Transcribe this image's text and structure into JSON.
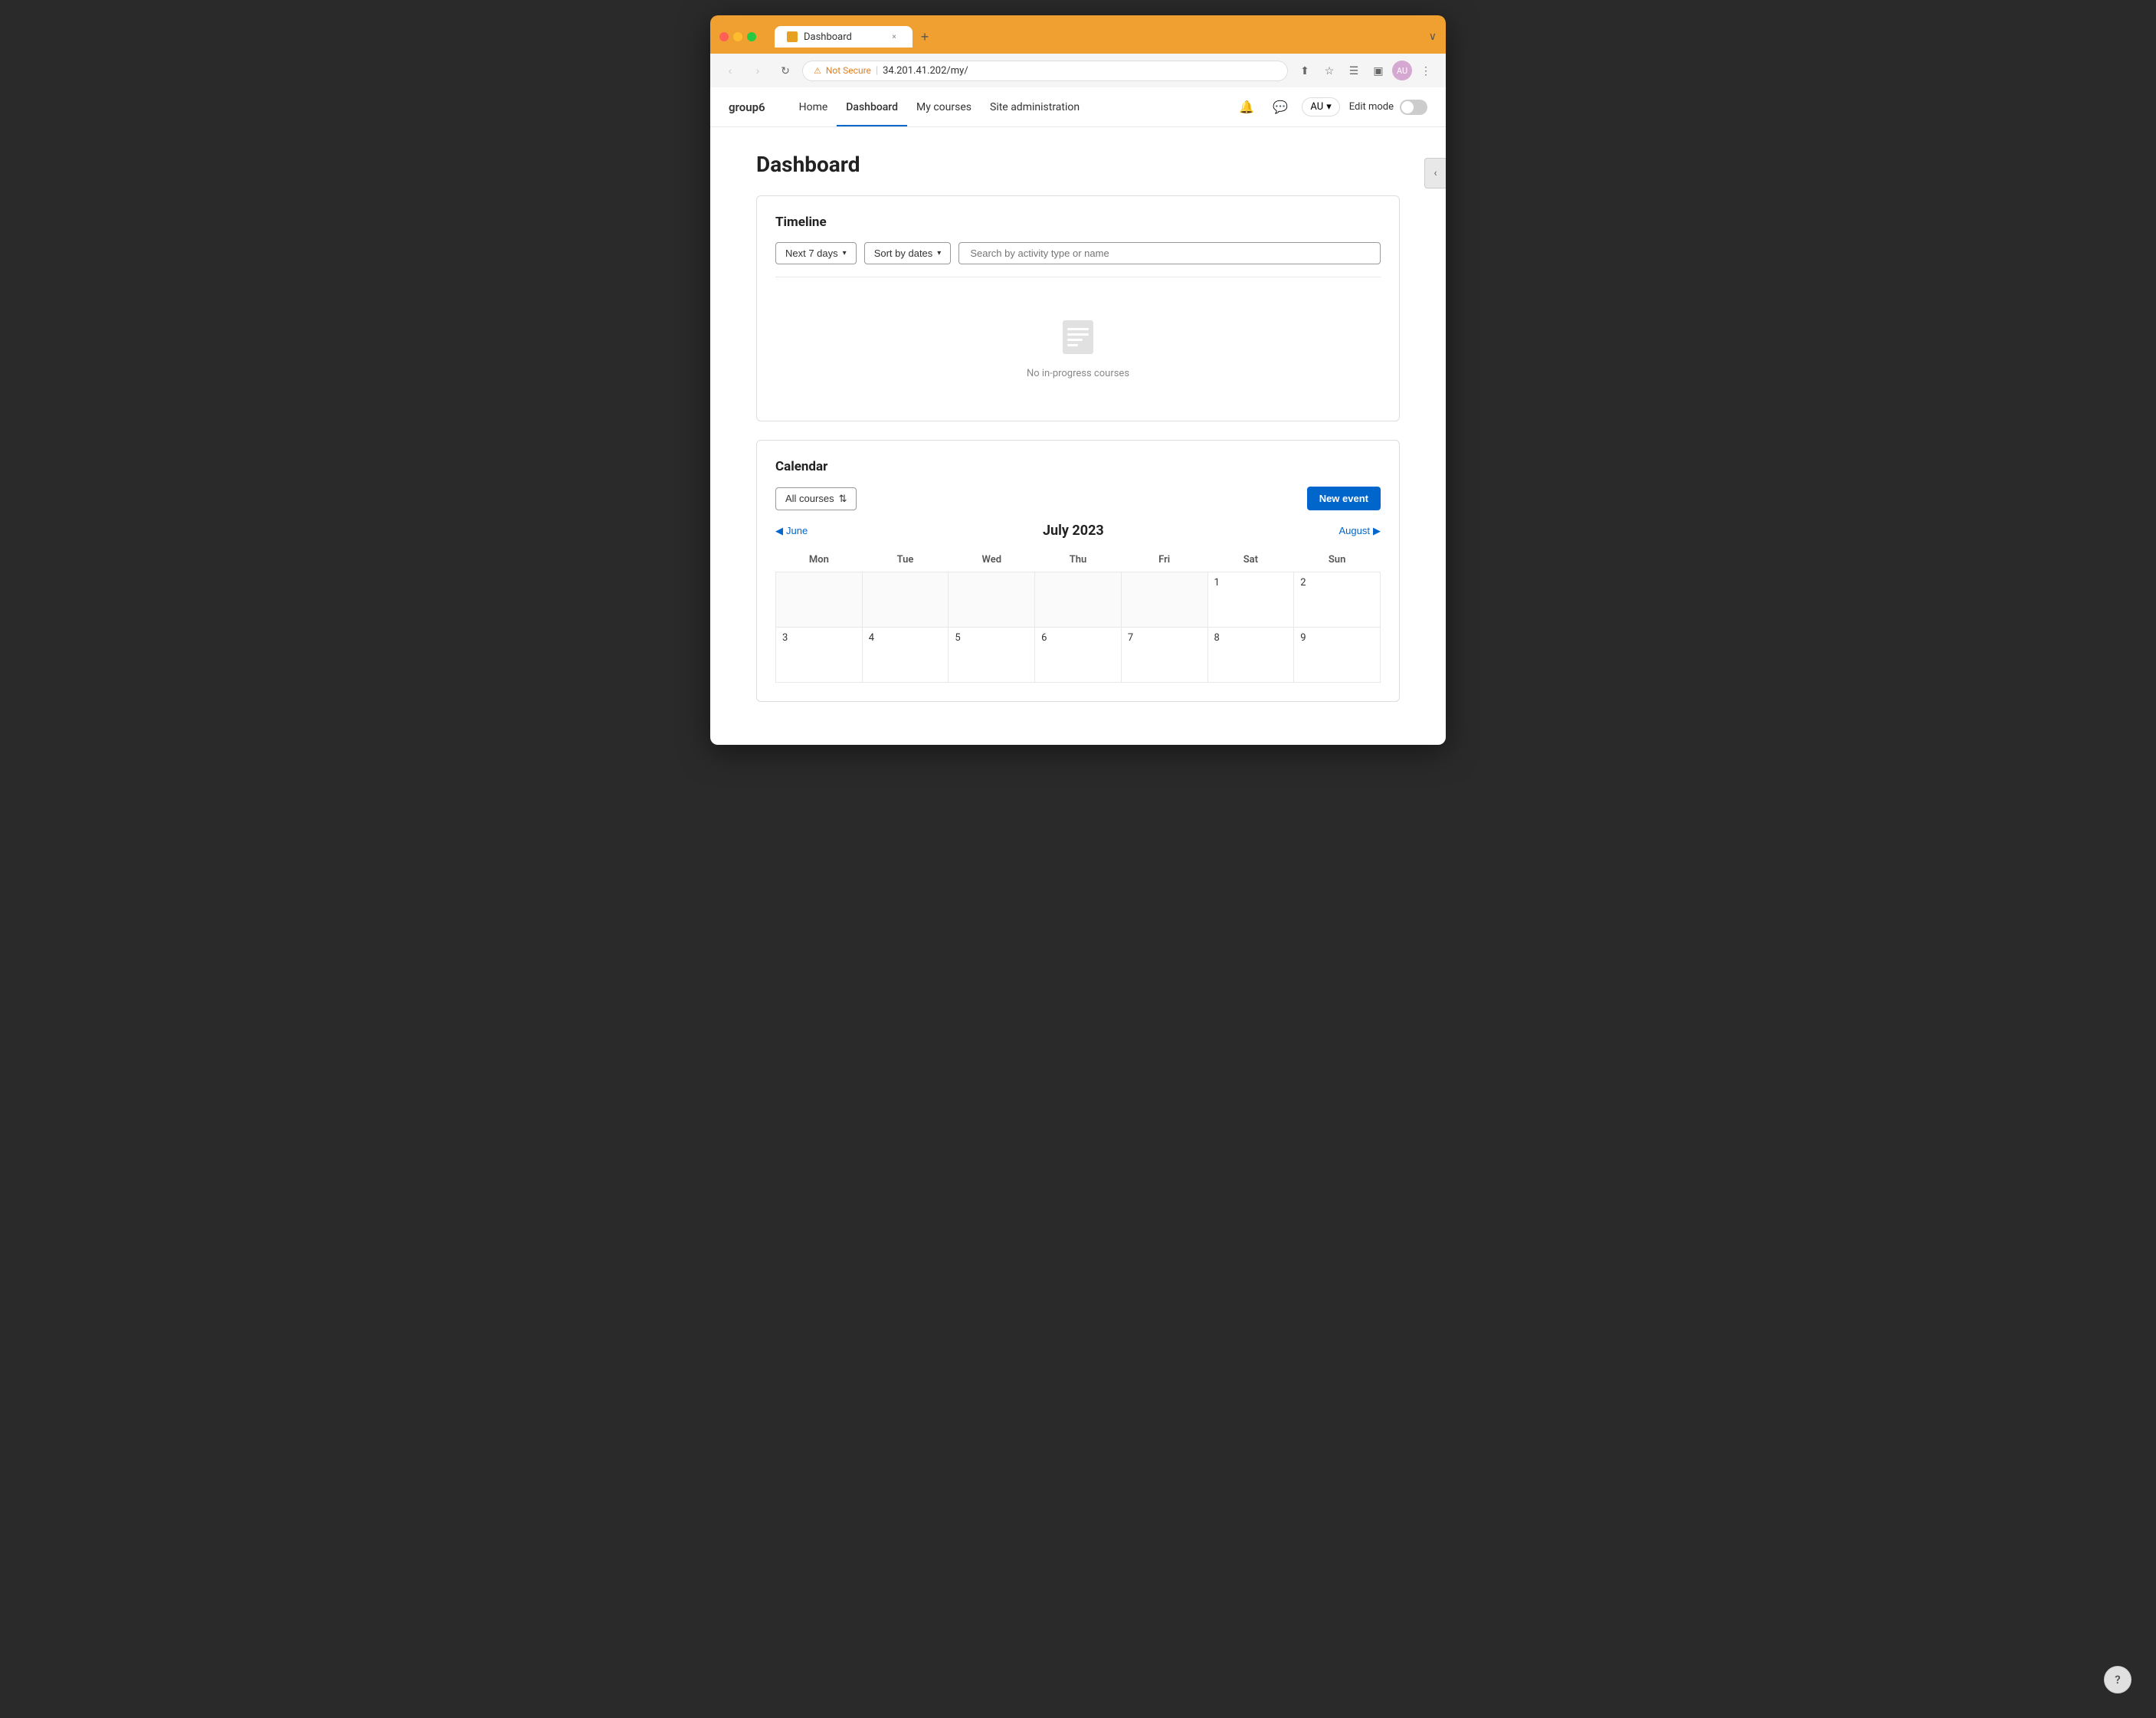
{
  "browser": {
    "tab_title": "Dashboard",
    "tab_close": "×",
    "tab_new": "+",
    "nav_back": "‹",
    "nav_forward": "›",
    "nav_reload": "↻",
    "address_not_secure": "Not Secure",
    "address_separator": "|",
    "address_url": "34.201.41.202/my/",
    "more_menu": "⋮",
    "chevron_down": "∨",
    "action_share": "⬆",
    "action_bookmark": "☆",
    "action_menu": "☰",
    "action_sidebar": "▣",
    "user_avatar_text": "AU"
  },
  "nav": {
    "logo": "group6",
    "links": [
      {
        "label": "Home",
        "active": false
      },
      {
        "label": "Dashboard",
        "active": true
      },
      {
        "label": "My courses",
        "active": false
      },
      {
        "label": "Site administration",
        "active": false
      }
    ],
    "bell_icon": "🔔",
    "chat_icon": "💬",
    "user_label": "AU",
    "user_chevron": "▾",
    "edit_mode_label": "Edit mode"
  },
  "page": {
    "title": "Dashboard"
  },
  "timeline": {
    "section_title": "Timeline",
    "filter_label": "Next 7 days",
    "filter_chevron": "▾",
    "sort_label": "Sort by dates",
    "sort_chevron": "▾",
    "search_placeholder": "Search by activity type or name",
    "empty_text": "No in-progress courses"
  },
  "calendar": {
    "section_title": "Calendar",
    "all_courses_label": "All courses",
    "all_courses_icon": "⇅",
    "new_event_label": "New event",
    "prev_month": "June",
    "prev_arrow": "◀",
    "next_month": "August",
    "next_arrow": "▶",
    "month_title": "July 2023",
    "days": [
      "Mon",
      "Tue",
      "Wed",
      "Thu",
      "Fri",
      "Sat",
      "Sun"
    ],
    "weeks": [
      [
        "",
        "",
        "",
        "",
        "",
        "1",
        "2"
      ],
      [
        "3",
        "4",
        "5",
        "6",
        "7",
        "8",
        "9"
      ]
    ]
  },
  "sidebar_toggle": "‹",
  "help_label": "?"
}
